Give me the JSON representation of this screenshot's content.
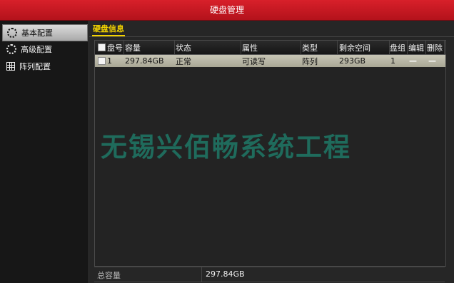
{
  "window": {
    "title": "硬盘管理"
  },
  "sidebar": {
    "items": [
      {
        "label": "基本配置",
        "icon": "gear-icon",
        "active": true
      },
      {
        "label": "高级配置",
        "icon": "gear-advanced-icon",
        "active": false
      },
      {
        "label": "阵列配置",
        "icon": "array-grid-icon",
        "active": false
      }
    ]
  },
  "main": {
    "tab": "硬盘信息",
    "table": {
      "headers": [
        "盘号",
        "容量",
        "状态",
        "属性",
        "类型",
        "剩余空间",
        "盘组",
        "编辑",
        "删除"
      ],
      "rows": [
        {
          "disk_no": "1",
          "capacity": "297.84GB",
          "status": "正常",
          "attribute": "可读写",
          "type": "阵列",
          "free_space": "293GB",
          "group": "1",
          "edit": "—",
          "delete": "—"
        }
      ]
    },
    "watermark": "无锡兴佰畅系统工程",
    "footer": {
      "label": "总容量",
      "value": "297.84GB"
    }
  },
  "colors": {
    "titlebar": "#c8161f",
    "tab_accent": "#f2d200",
    "selected_row": "#bdbbab",
    "watermark": "#1f6b5c"
  }
}
